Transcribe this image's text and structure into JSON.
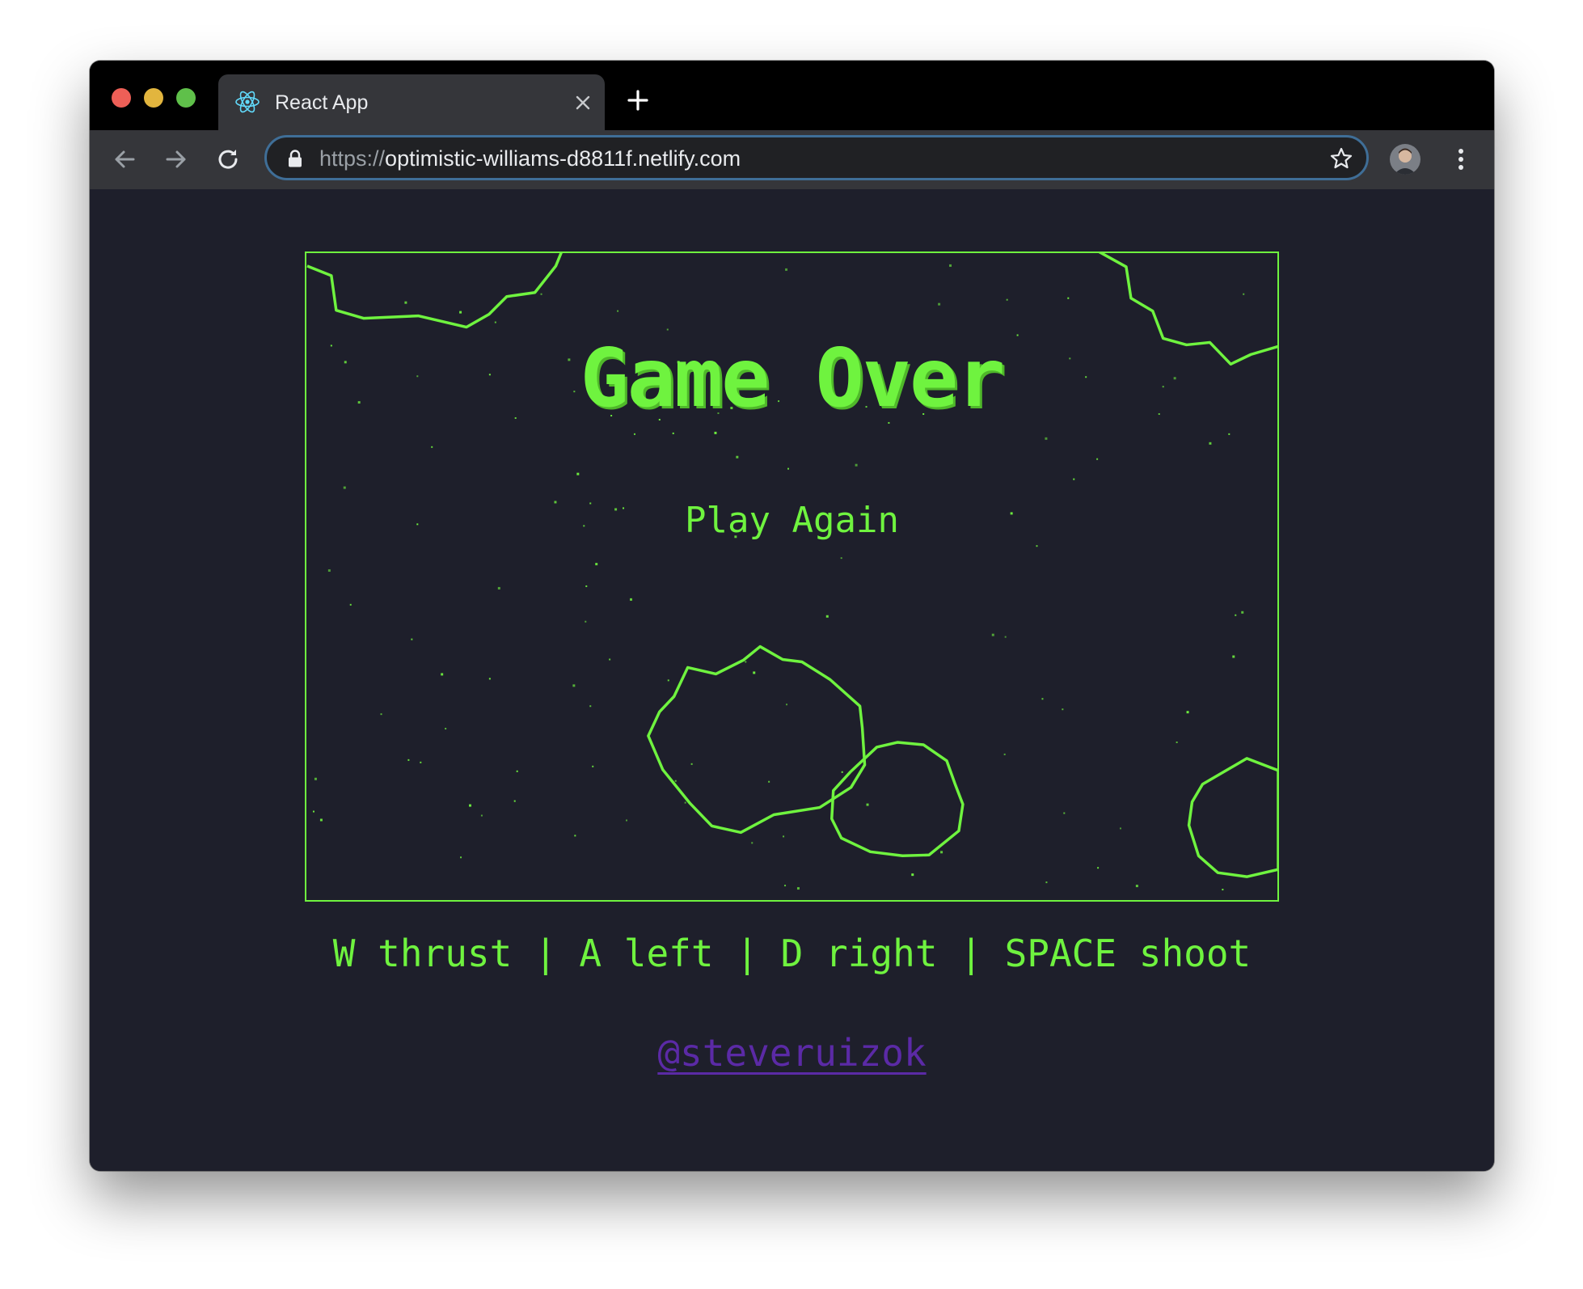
{
  "browser": {
    "tab_title": "React App",
    "url_scheme": "https://",
    "url_host": "optimistic-williams-d8811f.netlify.com",
    "icons": {
      "favicon": "react-logo-icon",
      "close": "close-icon",
      "new_tab": "plus-icon",
      "back": "arrow-back-icon",
      "forward": "arrow-forward-icon",
      "reload": "reload-icon",
      "lock": "lock-icon",
      "bookmark": "star-icon",
      "profile": "avatar-icon",
      "menu": "kebab-menu-icon"
    }
  },
  "game": {
    "title": "Game Over",
    "play_again_label": "Play Again",
    "controls_text": "W thrust | A left | D right | SPACE shoot",
    "author_link": "@steveruizok",
    "colors": {
      "accent": "#6ff33f",
      "link": "#5b2aa6",
      "background": "#1e1f2b"
    }
  }
}
